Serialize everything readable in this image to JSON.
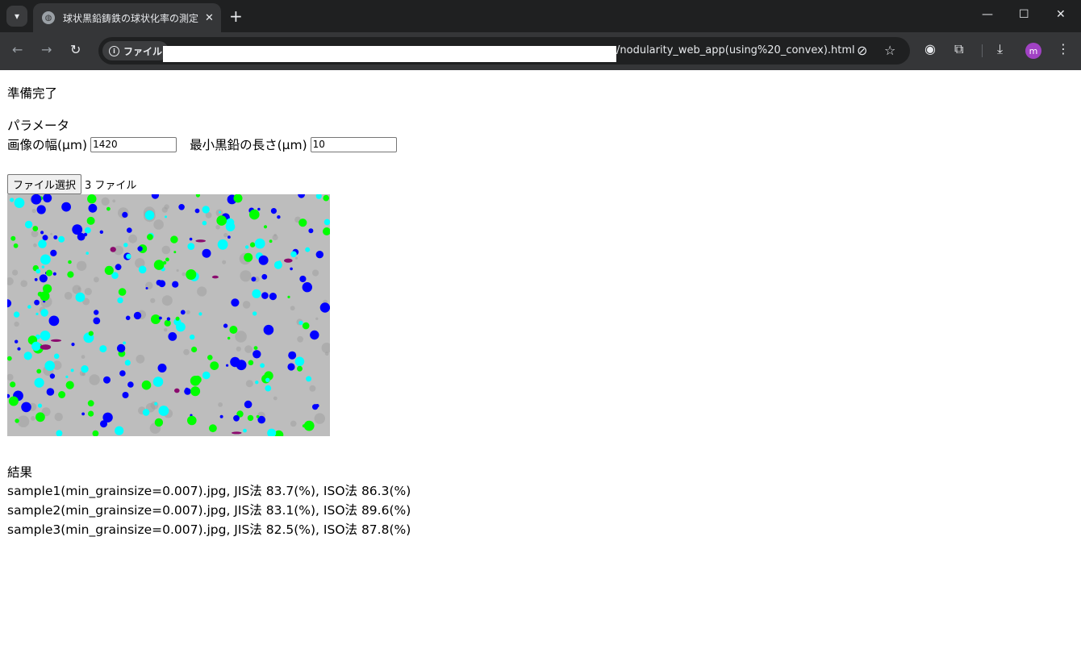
{
  "browser": {
    "tab_title": "球状黒鉛鋳鉄の球状化率の測定",
    "address_chip_label": "ファイル",
    "url": "/nodularity_web_app(using%20_convex).html",
    "avatar_letter": "m"
  },
  "page": {
    "status": "準備完了",
    "params_title": "パラメータ",
    "image_width_label": "画像の幅(μm)",
    "image_width_value": "1420",
    "min_graphite_label": "最小黒鉛の長さ(μm)",
    "min_graphite_value": "10",
    "file_button_label": "ファイル選択",
    "file_count": "3 ファイル",
    "results_title": "結果",
    "results": [
      "sample1(min_grainsize=0.007).jpg, JIS法 83.7(%), ISO法 86.3(%)",
      "sample2(min_grainsize=0.007).jpg, JIS法 83.1(%), ISO法 89.6(%)",
      "sample3(min_grainsize=0.007).jpg, JIS法 82.5(%), ISO法 87.8(%)"
    ]
  },
  "colors": {
    "nodule_blue": "#0000ff",
    "nodule_cyan": "#00ffff",
    "nodule_green": "#00ff00",
    "nodule_purple": "#8b0a6e",
    "matrix_gray": "#bdbdbd"
  }
}
